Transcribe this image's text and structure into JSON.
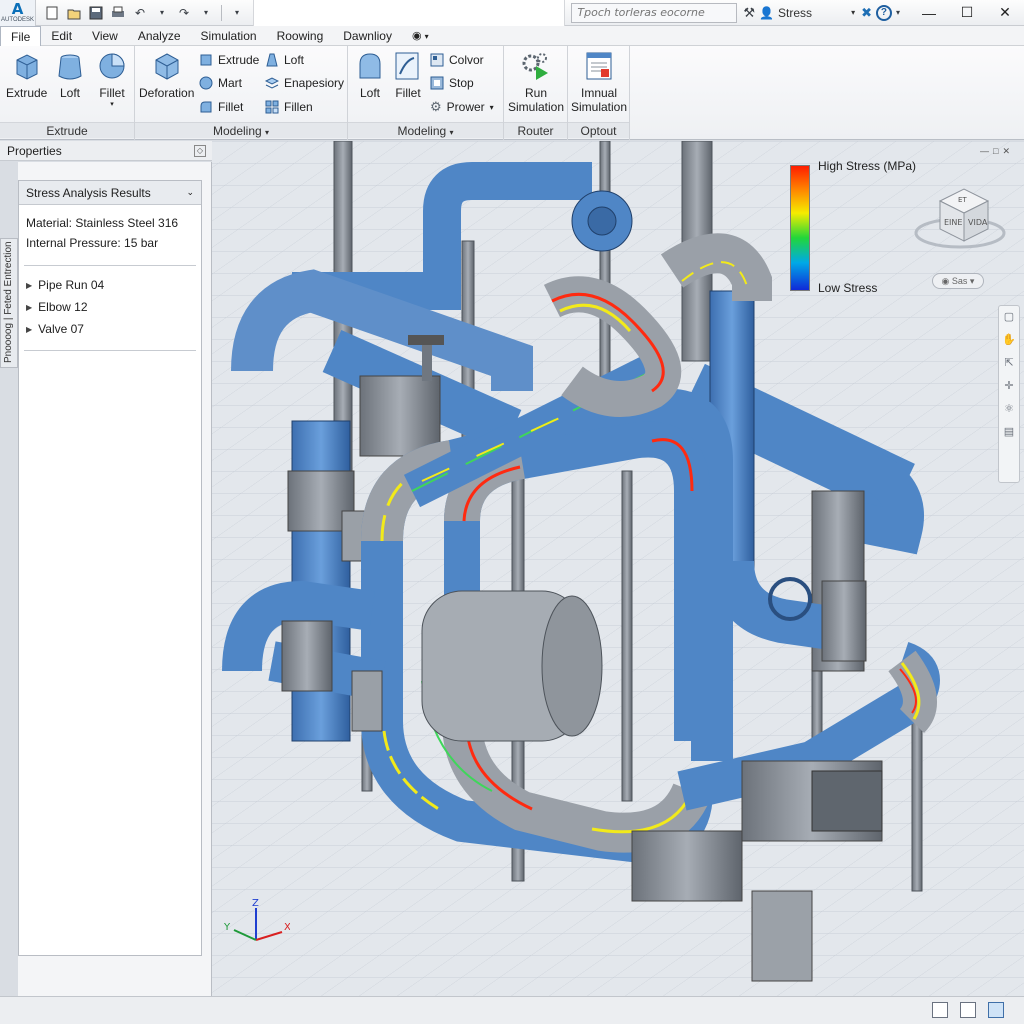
{
  "app": {
    "logo_letter": "A",
    "logo_text": "AUTODESK"
  },
  "quick_access": {
    "icons": [
      "new-icon",
      "open-icon",
      "save-icon",
      "print-icon",
      "undo-icon",
      "redo-icon",
      "more-icon"
    ]
  },
  "search": {
    "placeholder": "Tpoch torleras eocorne"
  },
  "user": {
    "name": "Stress"
  },
  "menu": {
    "items": [
      "File",
      "Edit",
      "View",
      "Analyze",
      "Simulation",
      "Roowing",
      "Dawnlioy"
    ],
    "active": "File"
  },
  "ribbon": {
    "extrude_group": {
      "label": "Extrude",
      "buttons": [
        "Extrude",
        "Loft",
        "Fillet"
      ]
    },
    "modeling_group1": {
      "label": "Modeling",
      "big_button": "Deforation",
      "small_buttons": [
        "Extrude",
        "Mart",
        "Fillet",
        "Loft",
        "Enapesiory",
        "Fillen"
      ]
    },
    "modeling_group2": {
      "label": "Modeling",
      "big_buttons": [
        "Loft",
        "Fillet"
      ],
      "small_buttons": [
        "Colvor",
        "Stop",
        "Prower"
      ]
    },
    "router_group": {
      "label": "Router",
      "button_line1": "Run",
      "button_line2": "Simulation"
    },
    "output_group": {
      "label": "Optout",
      "button_line1": "Imnual",
      "button_line2": "Simulation"
    }
  },
  "properties": {
    "title": "Properties",
    "side_tab": "Pnoooog | Feted Entrection",
    "section_title": "Stress Analysis Results",
    "material": "Material: Stainless Steel 316",
    "pressure": "Internal Pressure: 15 bar",
    "tree": [
      "Pipe Run 04",
      "Elbow 12",
      "Valve 07"
    ]
  },
  "legend": {
    "high": "High Stress (MPa)",
    "low": "Low Stress"
  },
  "viewcube": {
    "face1": "ET",
    "face2": "EINE",
    "face3": "VIDA",
    "zoom": "Sas"
  },
  "colors": {
    "pipe_blue": "#4f86c6",
    "pipe_gray": "#8b9199",
    "stress_red": "#ff2a10",
    "stress_yellow": "#f2ea1a",
    "stress_green": "#3fd65a",
    "grid": "#c3cad3"
  }
}
